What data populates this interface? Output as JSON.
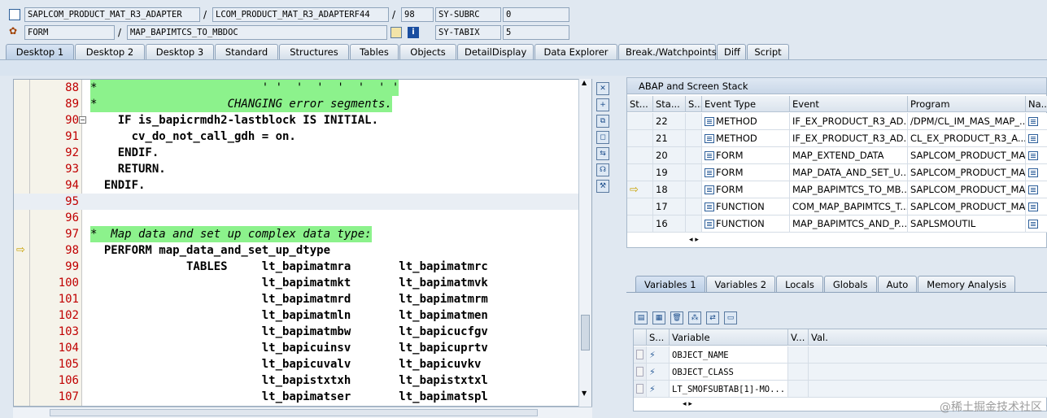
{
  "header": {
    "row1": {
      "program": "SAPLCOM_PRODUCT_MAT_R3_ADAPTER",
      "include": "LCOM_PRODUCT_MAT_R3_ADAPTERF44",
      "line": "98",
      "sysfield1": "SY-SUBRC",
      "sysvalue1": "0"
    },
    "row2": {
      "type": "FORM",
      "name": "MAP_BAPIMTCS_TO_MBDOC",
      "sysfield2": "SY-TABIX",
      "sysvalue2": "5"
    }
  },
  "tabs": [
    "Desktop 1",
    "Desktop 2",
    "Desktop 3",
    "Standard",
    "Structures",
    "Tables",
    "Objects",
    "DetailDisplay",
    "Data Explorer",
    "Break./Watchpoints",
    "Diff",
    "Script"
  ],
  "code": [
    {
      "n": "88",
      "t": "*                        ' '  '  '  '  '  ' '",
      "c": true
    },
    {
      "n": "89",
      "t": "*                   CHANGING error segments.",
      "c": true
    },
    {
      "n": "90",
      "t": "    IF is_bapicrmdh2-lastblock IS INITIAL.",
      "c": false
    },
    {
      "n": "91",
      "t": "      cv_do_not_call_gdh = on.",
      "c": false
    },
    {
      "n": "92",
      "t": "    ENDIF.",
      "c": false
    },
    {
      "n": "93",
      "t": "    RETURN.",
      "c": false
    },
    {
      "n": "94",
      "t": "  ENDIF.",
      "c": false
    },
    {
      "n": "95",
      "t": "",
      "c": false
    },
    {
      "n": "96",
      "t": "",
      "c": false
    },
    {
      "n": "97",
      "t": "*  Map data and set up complex data type:",
      "c": true
    },
    {
      "n": "98",
      "t": "  PERFORM map_data_and_set_up_dtype",
      "c": false
    },
    {
      "n": "99",
      "t": "              TABLES     lt_bapimatmra       lt_bapimatmrc",
      "c": false
    },
    {
      "n": "100",
      "t": "                         lt_bapimatmkt       lt_bapimatmvk",
      "c": false
    },
    {
      "n": "101",
      "t": "                         lt_bapimatmrd       lt_bapimatmrm",
      "c": false
    },
    {
      "n": "102",
      "t": "                         lt_bapimatmln       lt_bapimatmen",
      "c": false
    },
    {
      "n": "103",
      "t": "                         lt_bapimatmbw       lt_bapicucfgv",
      "c": false
    },
    {
      "n": "104",
      "t": "                         lt_bapicuinsv       lt_bapicuprtv",
      "c": false
    },
    {
      "n": "105",
      "t": "                         lt_bapicuvalv       lt_bapicuvkv",
      "c": false
    },
    {
      "n": "106",
      "t": "                         lt_bapistxtxh       lt_bapistxtxl",
      "c": false
    },
    {
      "n": "107",
      "t": "                         lt_bapimatser       lt_bapimatspl",
      "c": false
    }
  ],
  "stack": {
    "title": "ABAP and Screen Stack",
    "columns": [
      "St...",
      "Sta...",
      "S...",
      "Event Type",
      "Event",
      "Program",
      "Na..."
    ],
    "rows": [
      {
        "level": "22",
        "type": "METHOD",
        "event": "IF_EX_PRODUCT_R3_AD...",
        "program": "/DPM/CL_IM_MAS_MAP_...",
        "current": false
      },
      {
        "level": "21",
        "type": "METHOD",
        "event": "IF_EX_PRODUCT_R3_AD...",
        "program": "CL_EX_PRODUCT_R3_A...",
        "current": false
      },
      {
        "level": "20",
        "type": "FORM",
        "event": "MAP_EXTEND_DATA",
        "program": "SAPLCOM_PRODUCT_MA...",
        "current": false
      },
      {
        "level": "19",
        "type": "FORM",
        "event": "MAP_DATA_AND_SET_U...",
        "program": "SAPLCOM_PRODUCT_MA...",
        "current": false
      },
      {
        "level": "18",
        "type": "FORM",
        "event": "MAP_BAPIMTCS_TO_MB...",
        "program": "SAPLCOM_PRODUCT_MA...",
        "current": true
      },
      {
        "level": "17",
        "type": "FUNCTION",
        "event": "COM_MAP_BAPIMTCS_T...",
        "program": "SAPLCOM_PRODUCT_MA...",
        "current": false
      },
      {
        "level": "16",
        "type": "FUNCTION",
        "event": "MAP_BAPIMTCS_AND_P...",
        "program": "SAPLSMOUTIL",
        "current": false
      }
    ]
  },
  "vartabs": [
    "Variables 1",
    "Variables 2",
    "Locals",
    "Globals",
    "Auto",
    "Memory Analysis"
  ],
  "vars": {
    "columns": [
      "S...",
      "Variable",
      "V...",
      "Val."
    ],
    "rows": [
      "OBJECT_NAME",
      "OBJECT_CLASS",
      "LT_SMOFSUBTAB[1]-MO..."
    ]
  },
  "watermark": "@稀土掘金技术社区"
}
